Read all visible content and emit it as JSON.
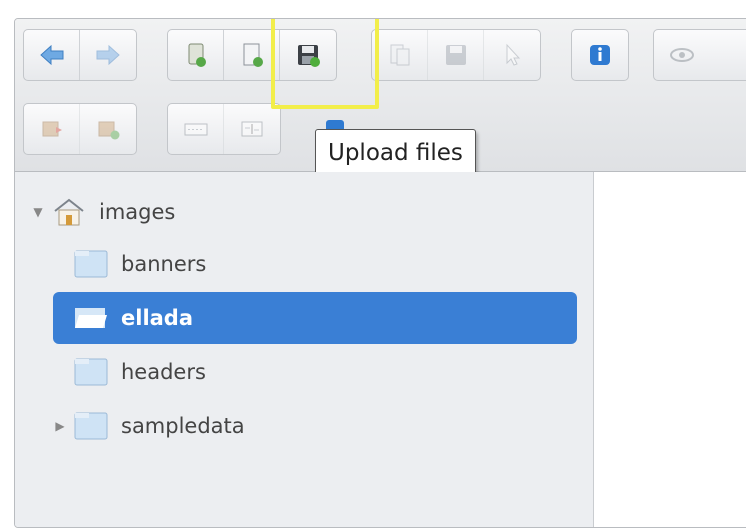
{
  "toolbar": {
    "tooltip": "Upload files",
    "row1": [
      {
        "group": "navigation",
        "buttons": [
          {
            "name": "back-button",
            "icon": "arrow-left-icon"
          },
          {
            "name": "forward-button",
            "icon": "arrow-right-icon"
          }
        ]
      },
      {
        "group": "file-actions",
        "buttons": [
          {
            "name": "new-folder-button",
            "icon": "new-folder-icon"
          },
          {
            "name": "new-file-button",
            "icon": "new-file-icon"
          },
          {
            "name": "upload-files-button",
            "icon": "save-upload-icon"
          }
        ]
      },
      {
        "group": "edit-actions",
        "buttons": [
          {
            "name": "copy-button",
            "icon": "copy-icon"
          },
          {
            "name": "save-button",
            "icon": "save-icon"
          },
          {
            "name": "paste-button",
            "icon": "paste-icon"
          }
        ]
      },
      {
        "group": "info",
        "buttons": [
          {
            "name": "info-button",
            "icon": "info-icon"
          }
        ]
      },
      {
        "group": "view",
        "buttons": [
          {
            "name": "preview-button",
            "icon": "eye-icon"
          }
        ]
      }
    ],
    "row2": [
      {
        "group": "folder-ops",
        "buttons": [
          {
            "name": "folder-move-button",
            "icon": "folder-move-icon"
          },
          {
            "name": "folder-add-button",
            "icon": "folder-add-icon"
          }
        ]
      },
      {
        "group": "rename",
        "buttons": [
          {
            "name": "rename-button",
            "icon": "rename-icon"
          },
          {
            "name": "text-edit-button",
            "icon": "text-edit-icon"
          }
        ]
      }
    ]
  },
  "tree": {
    "root": {
      "label": "images",
      "icon": "home-icon",
      "expanded": true
    },
    "items": [
      {
        "label": "banners",
        "selected": false,
        "expandable": false
      },
      {
        "label": "ellada",
        "selected": true,
        "expandable": false
      },
      {
        "label": "headers",
        "selected": false,
        "expandable": false
      },
      {
        "label": "sampledata",
        "selected": false,
        "expandable": true
      }
    ]
  },
  "colors": {
    "selected_bg": "#3a7fd5",
    "highlight": "#f2ee4a",
    "tree_bg": "#eceef1"
  }
}
